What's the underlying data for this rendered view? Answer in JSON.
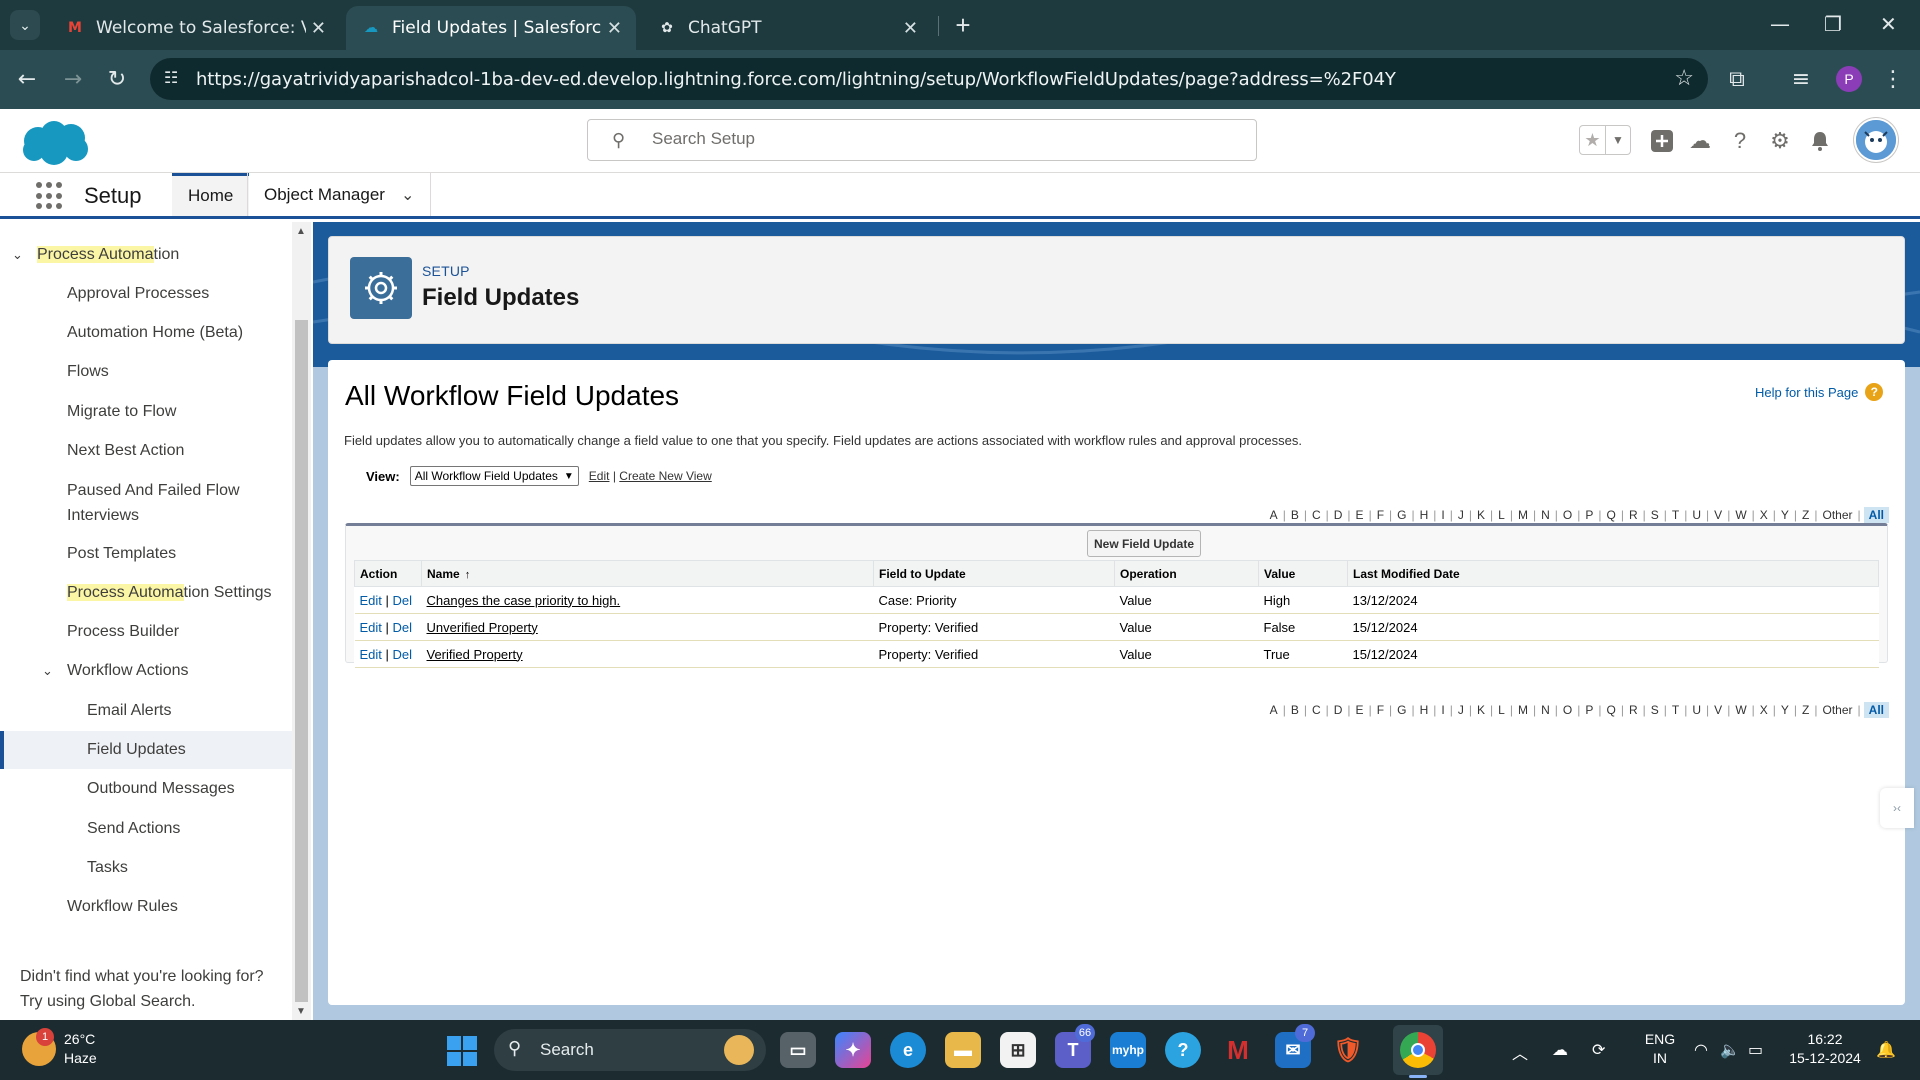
{
  "browser": {
    "tabs": [
      {
        "title": "Welcome to Salesforce: Verify y",
        "icon": "gmail-icon"
      },
      {
        "title": "Field Updates | Salesforce",
        "icon": "salesforce-cloud-icon"
      },
      {
        "title": "ChatGPT",
        "icon": "chatgpt-icon"
      }
    ],
    "url": "https://gayatrividyaparishadcol-1ba-dev-ed.develop.lightning.force.com/lightning/setup/WorkflowFieldUpdates/page?address=%2F04Y",
    "profile_initial": "P"
  },
  "header": {
    "search_placeholder": "Search Setup"
  },
  "nav": {
    "app_name": "Setup",
    "tabs": [
      "Home",
      "Object Manager"
    ]
  },
  "sidebar": {
    "section_prefix": "Process Automa",
    "section_suffix": "tion",
    "items": [
      "Approval Processes",
      "Automation Home (Beta)",
      "Flows",
      "Migrate to Flow",
      "Next Best Action",
      "Paused And Failed Flow Interviews",
      "Post Templates",
      "Process Automation Settings",
      "Process Builder",
      "Workflow Actions"
    ],
    "settings_prefix": "Process Automa",
    "settings_suffix": "tion Settings",
    "workflow_children": [
      "Email Alerts",
      "Field Updates",
      "Outbound Messages",
      "Send Actions",
      "Tasks"
    ],
    "workflow_rules": "Workflow Rules",
    "footer_line1": "Didn't find what you're looking for?",
    "footer_line2": "Try using Global Search."
  },
  "page_header": {
    "kicker": "SETUP",
    "title": "Field Updates"
  },
  "content": {
    "title": "All Workflow Field Updates",
    "help_link": "Help for this Page",
    "description": "Field updates allow you to automatically change a field value to one that you specify. Field updates are actions associated with workflow rules and approval processes.",
    "view_label": "View:",
    "view_selected": "All Workflow Field Updates",
    "edit_link": "Edit",
    "create_view_link": "Create New View",
    "alphabet": [
      "A",
      "B",
      "C",
      "D",
      "E",
      "F",
      "G",
      "H",
      "I",
      "J",
      "K",
      "L",
      "M",
      "N",
      "O",
      "P",
      "Q",
      "R",
      "S",
      "T",
      "U",
      "V",
      "W",
      "X",
      "Y",
      "Z",
      "Other"
    ],
    "alpha_all": "All",
    "new_button": "New Field Update",
    "columns": [
      "Action",
      "Name",
      "Field to Update",
      "Operation",
      "Value",
      "Last Modified Date"
    ],
    "rows": [
      {
        "edit": "Edit",
        "del": "Del",
        "name": "Changes the case priority to high.",
        "field": "Case: Priority",
        "operation": "Value",
        "value": "High",
        "modified": "13/12/2024"
      },
      {
        "edit": "Edit",
        "del": "Del",
        "name": "Unverified Property",
        "field": "Property: Verified",
        "operation": "Value",
        "value": "False",
        "modified": "15/12/2024"
      },
      {
        "edit": "Edit",
        "del": "Del",
        "name": "Verified Property",
        "field": "Property: Verified",
        "operation": "Value",
        "value": "True",
        "modified": "15/12/2024"
      }
    ]
  },
  "taskbar": {
    "weather_temp": "26°C",
    "weather_desc": "Haze",
    "weather_badge": "1",
    "search_label": "Search",
    "teams_badge": "66",
    "outlook_badge": "7",
    "lang_line1": "ENG",
    "lang_line2": "IN",
    "time": "16:22",
    "date": "15-12-2024"
  },
  "colors": {
    "brand_blue": "#1b5297",
    "band_blue": "#1b5b9c",
    "chrome_dark": "#1e3a3f",
    "taskbar": "#1c2b30"
  }
}
